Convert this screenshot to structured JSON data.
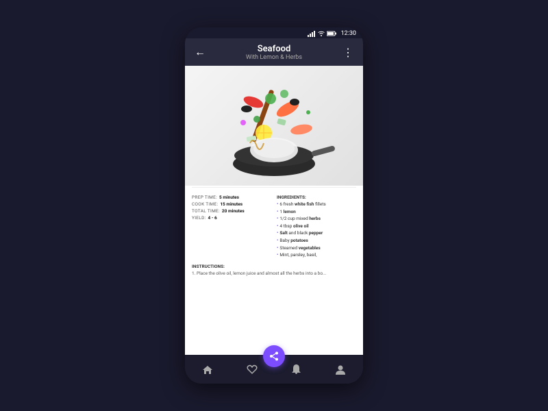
{
  "status_bar": {
    "time": "12:30"
  },
  "top_bar": {
    "back_icon": "←",
    "title": "Seafood",
    "subtitle": "With Lemon & Herbs",
    "more_icon": "⋮"
  },
  "recipe_meta": {
    "prep_label": "PREP TIME:",
    "prep_value": "5 minutes",
    "cook_label": "COOK TIME:",
    "cook_value": "15 minutes",
    "total_label": "TOTAL TIME:",
    "total_value": "20 minutes",
    "yield_label": "YIELD:",
    "yield_value": "4 - 6"
  },
  "ingredients": {
    "label": "INGREDIENTS:",
    "items": [
      {
        "text": "6 fresh ",
        "bold": "white fish",
        "rest": " fillets"
      },
      {
        "text": "1 ",
        "bold": "lemon",
        "rest": ""
      },
      {
        "text": "1/2 cup mixed ",
        "bold": "herbs",
        "rest": ""
      },
      {
        "text": "4 tbsp ",
        "bold": "olive oil",
        "rest": ""
      },
      {
        "text": "",
        "bold": "Salt",
        "rest": " and black pepper"
      },
      {
        "text": "Baby ",
        "bold": "potatoes",
        "rest": ""
      },
      {
        "text": "Steamed ",
        "bold": "vegetables",
        "rest": ""
      },
      {
        "text": "Mint, parsley, basil,",
        "bold": "",
        "rest": ""
      }
    ]
  },
  "instructions": {
    "label": "INSTRUCTIONS:",
    "text": "1. Place the olive oil, lemon juice and almost all the herbs into a bo..."
  },
  "bottom_nav": {
    "home_icon": "⌂",
    "star_icon": "☆",
    "share_icon": "↑",
    "bell_icon": "🔔",
    "user_icon": "👤"
  }
}
